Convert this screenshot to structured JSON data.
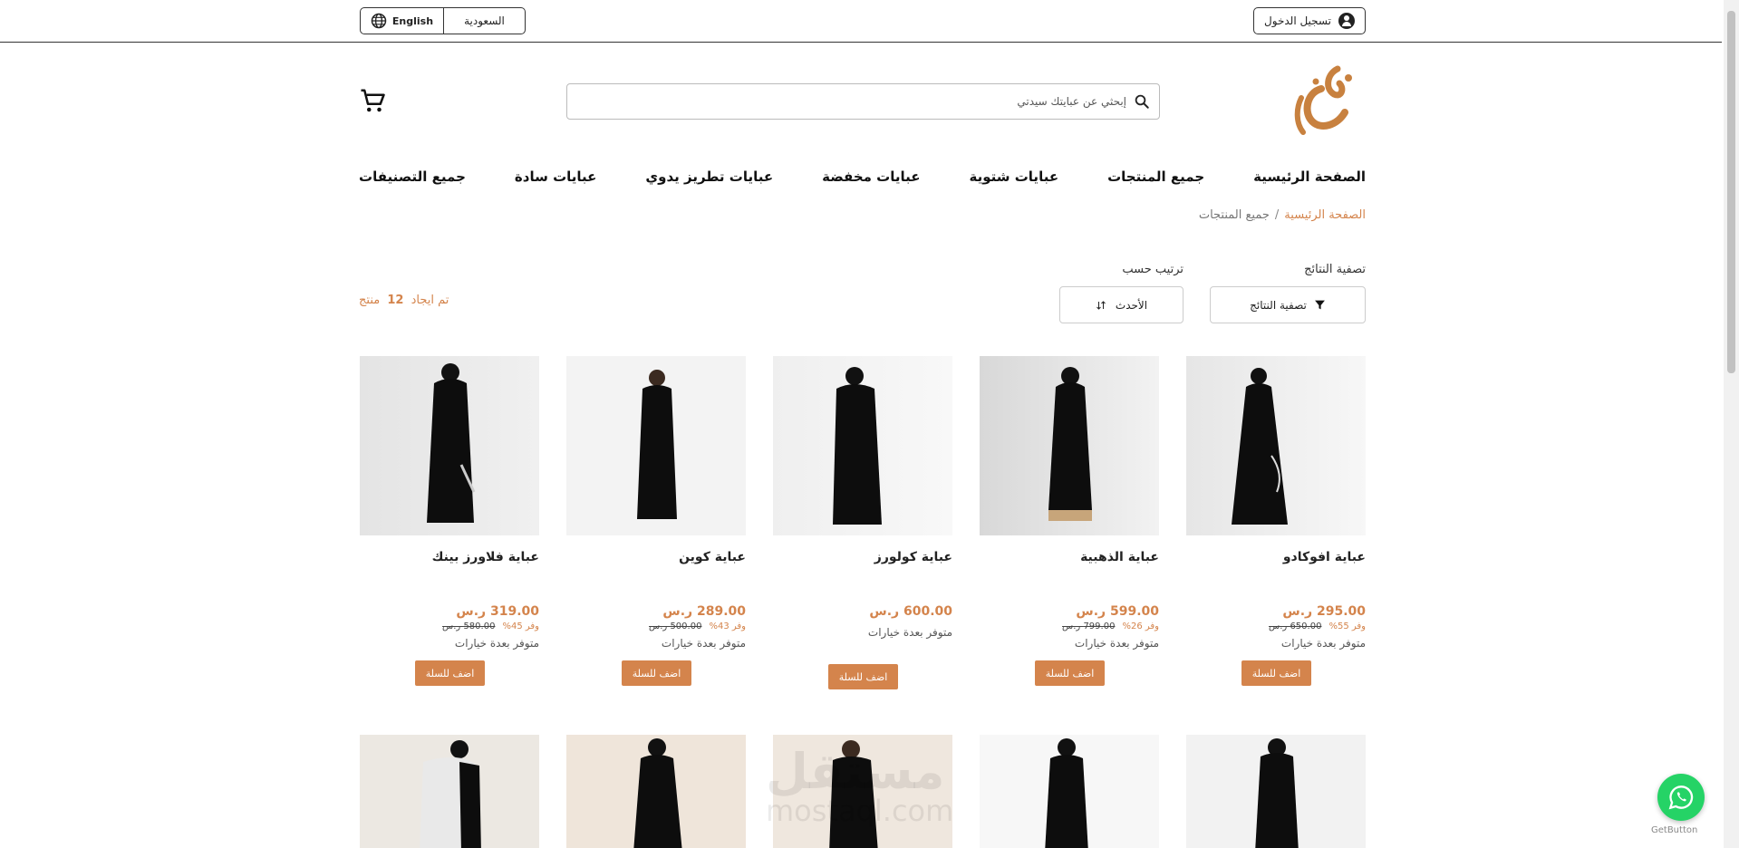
{
  "topbar": {
    "login_label": "تسجيل الدخول",
    "language_label": "English",
    "country_label": "السعودية"
  },
  "search": {
    "placeholder": "إبحثي عن عبايتك سيدتي"
  },
  "nav": {
    "items": [
      "الصفحة الرئيسية",
      "جميع المنتجات",
      "عبايات شتوية",
      "عبايات مخفضة",
      "عبايات تطريز يدوي",
      "عبايات سادة",
      "جميع التصنيفات"
    ]
  },
  "breadcrumb": {
    "home": "الصفحة الرئيسية",
    "separator": "/",
    "current": "جميع المنتجات"
  },
  "filters": {
    "filter_title": "تصفية النتائج",
    "filter_button": "تصفية النتائج",
    "sort_title": "ترتيب حسب",
    "sort_value": "الأحدث",
    "results_prefix": "تم ايجاد",
    "results_count": "12",
    "results_suffix": "منتج"
  },
  "products": [
    {
      "name": "عباية افوكادو",
      "price": "295.00 ر.س",
      "old_price": "650.00 ر.س",
      "save": "وفر 55%",
      "avail": "متوفر بعدة خيارات",
      "add": "اضف للسلة"
    },
    {
      "name": "عباية الذهبية",
      "price": "599.00 ر.س",
      "old_price": "799.00 ر.س",
      "save": "وفر 26%",
      "avail": "متوفر بعدة خيارات",
      "add": "اضف للسلة"
    },
    {
      "name": "عباية كولورز",
      "price": "600.00 ر.س",
      "old_price": "",
      "save": "",
      "avail": "متوفر بعدة خيارات",
      "add": "اضف للسلة"
    },
    {
      "name": "عباية كوين",
      "price": "289.00 ر.س",
      "old_price": "500.00 ر.س",
      "save": "وفر 43%",
      "avail": "متوفر بعدة خيارات",
      "add": "اضف للسلة"
    },
    {
      "name": "عباية فلاورز بينك",
      "price": "319.00 ر.س",
      "old_price": "580.00 ر.س",
      "save": "وفر 45%",
      "avail": "متوفر بعدة خيارات",
      "add": "اضف للسلة"
    }
  ],
  "watermark": {
    "arabic": "مستقل",
    "latin": "mostaql.com"
  },
  "footer_widget": {
    "label": "GetButton"
  },
  "colors": {
    "accent": "#d4844c",
    "whatsapp": "#25d366"
  },
  "icons": [
    "user-icon",
    "globe-icon",
    "search-icon",
    "cart-icon",
    "filter-icon",
    "sort-icon",
    "whatsapp-icon"
  ]
}
